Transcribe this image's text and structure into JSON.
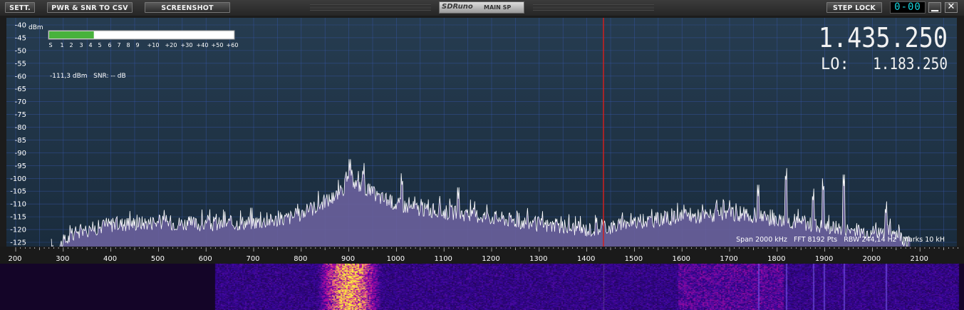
{
  "toolbar": {
    "sett_label": "SETT.",
    "csv_label": "PWR & SNR TO CSV",
    "screenshot_label": "SCREENSHOT",
    "step_lock_label": "STEP LOCK",
    "step_digits": "0-00",
    "minimize_symbol": "▁",
    "close_symbol": "✕"
  },
  "logo": {
    "brand": "SDRuno",
    "window_name": "MAIN SP"
  },
  "frequency": {
    "display": "1.435.250",
    "lo_label": "LO:",
    "lo_value": "1.183.250"
  },
  "smeter": {
    "unit_label": "dBm",
    "scale": [
      "S",
      "1",
      "2",
      "3",
      "4",
      "5",
      "6",
      "7",
      "8",
      "9",
      "+10",
      "+20",
      "+30",
      "+40",
      "+50",
      "+60"
    ],
    "level_fraction": 0.242,
    "readout": "-111,3 dBm   SNR: -- dB"
  },
  "status": {
    "text": "Span 2000 kHz   FFT 8192 Pts   RBW 244,14 Hz   Marks 10 kH"
  },
  "axes": {
    "y_ticks": [
      "-40",
      "-45",
      "-50",
      "-55",
      "-60",
      "-65",
      "-70",
      "-75",
      "-80",
      "-85",
      "-90",
      "-95",
      "-100",
      "-105",
      "-110",
      "-115",
      "-120",
      "-125"
    ],
    "x_ticks": [
      "200",
      "300",
      "400",
      "500",
      "600",
      "700",
      "800",
      "900",
      "1000",
      "1100",
      "1200",
      "1300",
      "1400",
      "1500",
      "1600",
      "1700",
      "1800",
      "1900",
      "2000",
      "2100"
    ],
    "x_range_khz": [
      200,
      2200
    ],
    "y_range_dbm": [
      -127,
      -38
    ],
    "marker_khz": 1435
  },
  "colors": {
    "plot_bg_top": "#263c50",
    "plot_bg_bottom": "#1a2c3d",
    "grid": "#3a5bb5",
    "spectrum_fill": "#6a609c",
    "spectrum_line": "#ffffff",
    "marker": "#d0201e",
    "smeter_bar": "#48b23c"
  },
  "chart_data": {
    "type": "area",
    "xlabel": "",
    "ylabel": "dBm",
    "x_unit": "kHz",
    "xlim": [
      200,
      2200
    ],
    "ylim": [
      -127,
      -38
    ],
    "envelope": [
      {
        "x": 275,
        "y": -129
      },
      {
        "x": 300,
        "y": -125
      },
      {
        "x": 330,
        "y": -121
      },
      {
        "x": 400,
        "y": -118
      },
      {
        "x": 500,
        "y": -117
      },
      {
        "x": 600,
        "y": -118
      },
      {
        "x": 700,
        "y": -117
      },
      {
        "x": 760,
        "y": -116
      },
      {
        "x": 800,
        "y": -114
      },
      {
        "x": 840,
        "y": -110
      },
      {
        "x": 880,
        "y": -106
      },
      {
        "x": 900,
        "y": -101
      },
      {
        "x": 930,
        "y": -103
      },
      {
        "x": 960,
        "y": -107
      },
      {
        "x": 1000,
        "y": -110
      },
      {
        "x": 1050,
        "y": -112
      },
      {
        "x": 1100,
        "y": -113
      },
      {
        "x": 1200,
        "y": -115
      },
      {
        "x": 1300,
        "y": -118
      },
      {
        "x": 1400,
        "y": -120
      },
      {
        "x": 1450,
        "y": -119
      },
      {
        "x": 1500,
        "y": -117
      },
      {
        "x": 1600,
        "y": -115
      },
      {
        "x": 1700,
        "y": -114
      },
      {
        "x": 1800,
        "y": -116
      },
      {
        "x": 1900,
        "y": -119
      },
      {
        "x": 2000,
        "y": -121
      },
      {
        "x": 2050,
        "y": -121
      },
      {
        "x": 2080,
        "y": -126
      }
    ],
    "spikes": [
      {
        "x": 902,
        "y": -97
      },
      {
        "x": 930,
        "y": -100
      },
      {
        "x": 1012,
        "y": -104
      },
      {
        "x": 1130,
        "y": -108
      },
      {
        "x": 1760,
        "y": -107
      },
      {
        "x": 1818,
        "y": -102
      },
      {
        "x": 1875,
        "y": -110
      },
      {
        "x": 1897,
        "y": -106
      },
      {
        "x": 1940,
        "y": -103
      },
      {
        "x": 2028,
        "y": -115
      }
    ]
  }
}
